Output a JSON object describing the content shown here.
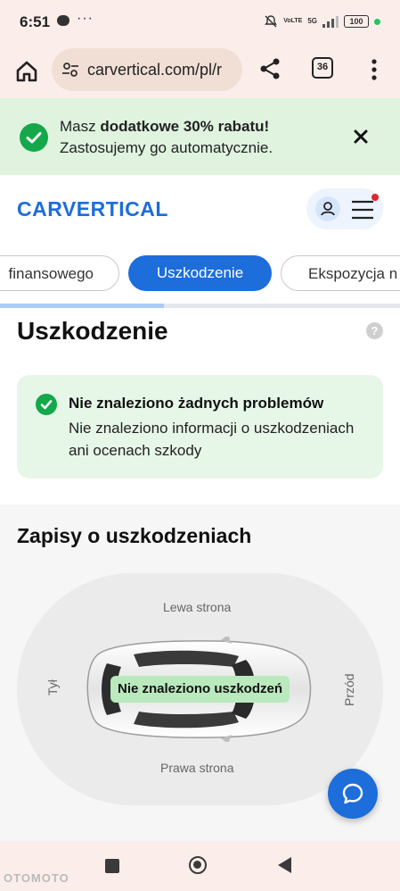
{
  "status_bar": {
    "time": "6:51",
    "more": "···",
    "network_top": "5G",
    "network_volte": "VoLTE",
    "battery": "100"
  },
  "browser": {
    "url": "carvertical.com/pl/r",
    "tab_count": "36"
  },
  "promo": {
    "prefix": "Masz ",
    "bold": "dodatkowe 30% rabatu!",
    "line2": "Zastosujemy go automatycznie."
  },
  "header": {
    "logo": "CARVERTICAL"
  },
  "report_tabs": {
    "items": [
      {
        "label": "finansowego"
      },
      {
        "label": "Uszkodzenie"
      },
      {
        "label": "Ekspozycja n"
      }
    ],
    "active_index": 1,
    "progress_fraction": 0.41
  },
  "damage_section": {
    "title": "Uszkodzenie",
    "help": "?",
    "status_heading": "Nie znaleziono żadnych problemów",
    "status_body": "Nie znaleziono informacji o uszkodzeniach ani ocenach szkody"
  },
  "records_section": {
    "title": "Zapisy o uszkodzeniach",
    "left_side": "Lewa strona",
    "right_side": "Prawa strona",
    "rear": "Tył",
    "front": "Przód",
    "no_damage": "Nie znaleziono uszkodzeń"
  },
  "watermark": "OTOMOTO",
  "colors": {
    "accent": "#1d6ddb",
    "success": "#14a84a",
    "success_bg": "#e6f6e7",
    "promo_bg": "#dff3df",
    "chrome_bg": "#fbeeea"
  }
}
